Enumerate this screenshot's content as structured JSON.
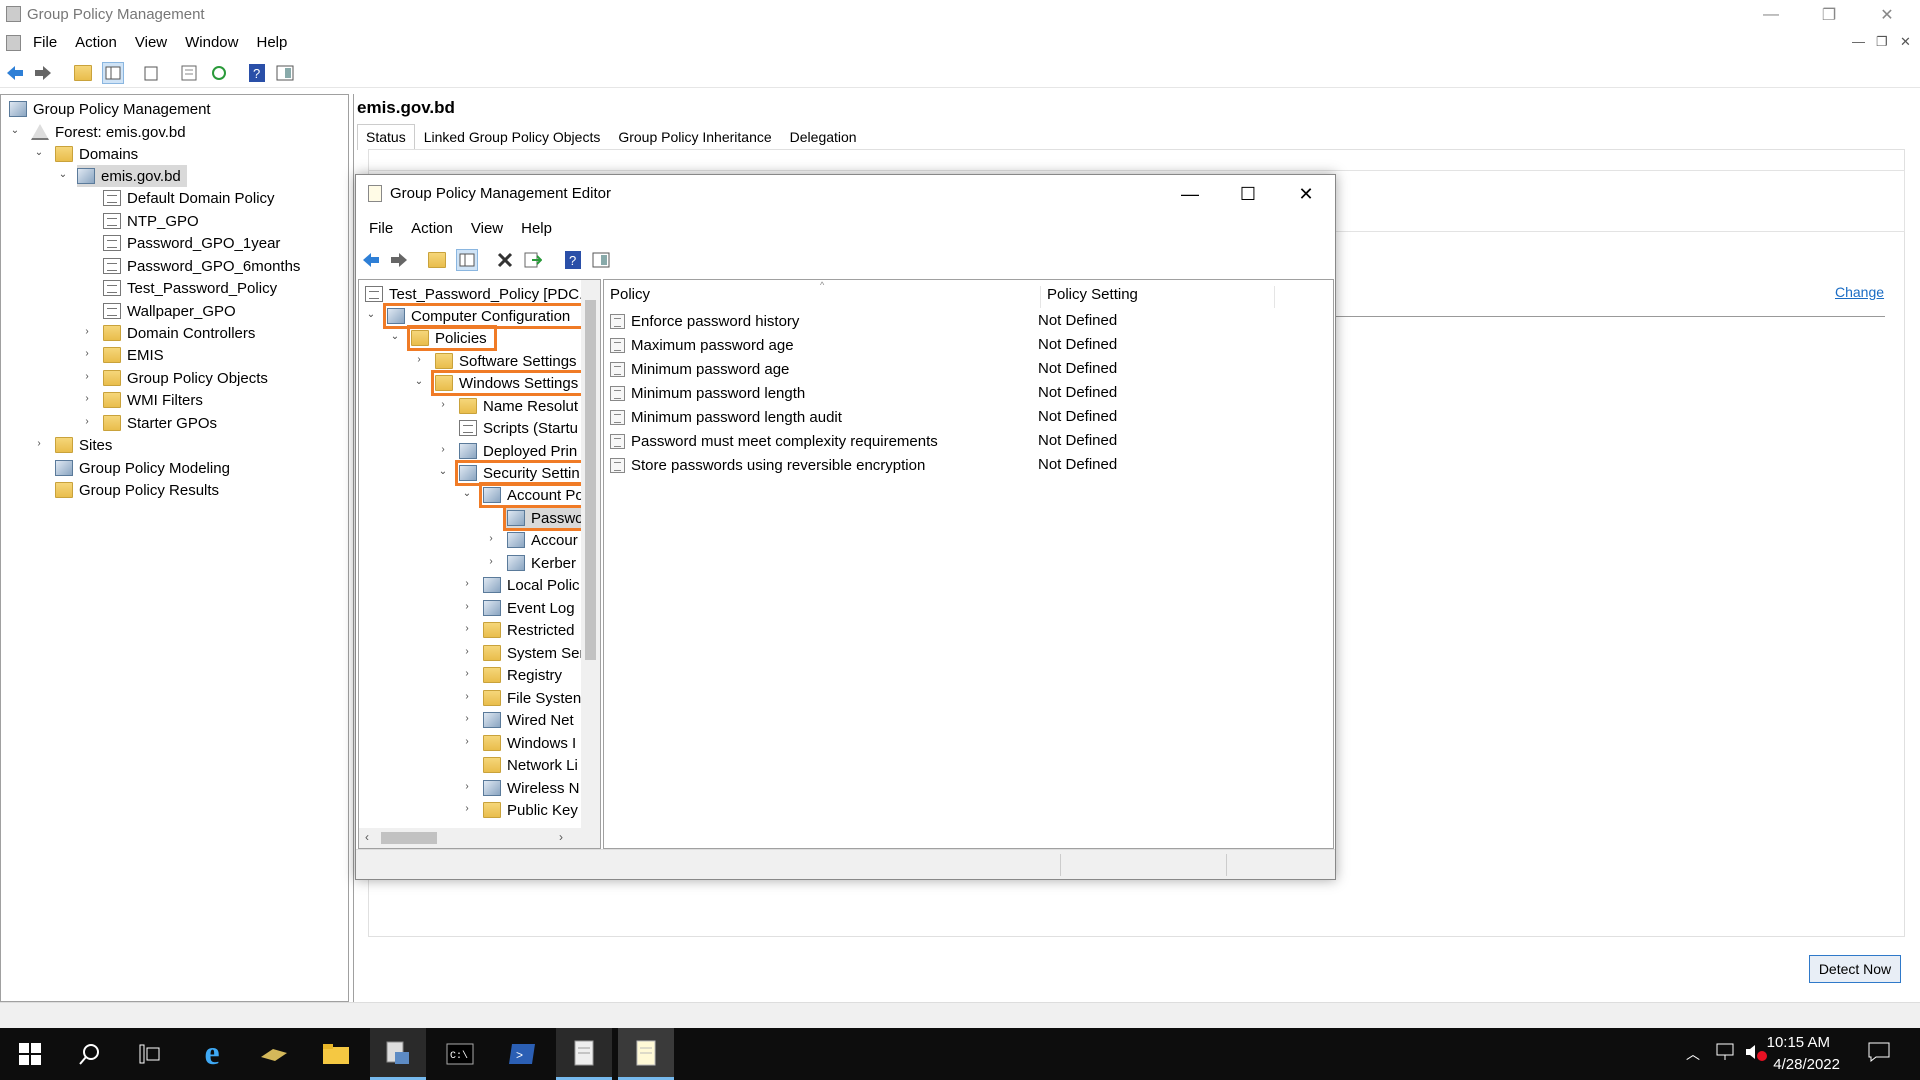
{
  "window": {
    "title": "Group Policy Management"
  },
  "menu": [
    "File",
    "Action",
    "View",
    "Window",
    "Help"
  ],
  "tree": {
    "root": "Group Policy Management",
    "forest": "Forest: emis.gov.bd",
    "domains": "Domains",
    "domain": "emis.gov.bd",
    "gpos": [
      "Default Domain Policy",
      "NTP_GPO",
      "Password_GPO_1year",
      "Password_GPO_6months",
      "Test_Password_Policy",
      "Wallpaper_GPO"
    ],
    "ous": [
      "Domain Controllers",
      "EMIS",
      "Group Policy Objects",
      "WMI Filters",
      "Starter GPOs"
    ],
    "sites": "Sites",
    "modeling": "Group Policy Modeling",
    "results": "Group Policy Results"
  },
  "right": {
    "title": "emis.gov.bd",
    "tabs": [
      "Status",
      "Linked Group Policy Objects",
      "Group Policy Inheritance",
      "Delegation"
    ],
    "change_link": "Change",
    "detect_button": "Detect Now"
  },
  "editor": {
    "title": "Group Policy Management Editor",
    "menu": [
      "File",
      "Action",
      "View",
      "Help"
    ],
    "tree_root": "Test_Password_Policy [PDC.EM",
    "tree": [
      {
        "label": "Computer Configuration",
        "level": 1
      },
      {
        "label": "Policies",
        "level": 2
      },
      {
        "label": "Software Settings",
        "level": 3
      },
      {
        "label": "Windows Settings",
        "level": 3
      },
      {
        "label": "Name Resolut",
        "level": 4
      },
      {
        "label": "Scripts (Startu",
        "level": 4
      },
      {
        "label": "Deployed Prin",
        "level": 4
      },
      {
        "label": "Security Settin",
        "level": 4
      },
      {
        "label": "Account Po",
        "level": 5
      },
      {
        "label": "Passwo",
        "level": 6
      },
      {
        "label": "Accour",
        "level": 6
      },
      {
        "label": "Kerber",
        "level": 6
      },
      {
        "label": "Local Polic",
        "level": 5
      },
      {
        "label": "Event Log",
        "level": 5
      },
      {
        "label": "Restricted",
        "level": 5
      },
      {
        "label": "System Ser",
        "level": 5
      },
      {
        "label": "Registry",
        "level": 5
      },
      {
        "label": "File Systen",
        "level": 5
      },
      {
        "label": "Wired Net",
        "level": 5
      },
      {
        "label": "Windows I",
        "level": 5
      },
      {
        "label": "Network Li",
        "level": 5
      },
      {
        "label": "Wireless N",
        "level": 5
      },
      {
        "label": "Public Key",
        "level": 5
      }
    ],
    "list_headers": [
      "Policy",
      "Policy Setting"
    ],
    "policies": [
      {
        "name": "Enforce password history",
        "setting": "Not Defined"
      },
      {
        "name": "Maximum password age",
        "setting": "Not Defined"
      },
      {
        "name": "Minimum password age",
        "setting": "Not Defined"
      },
      {
        "name": "Minimum password length",
        "setting": "Not Defined"
      },
      {
        "name": "Minimum password length audit",
        "setting": "Not Defined"
      },
      {
        "name": "Password must meet complexity requirements",
        "setting": "Not Defined"
      },
      {
        "name": "Store passwords using reversible encryption",
        "setting": "Not Defined"
      }
    ]
  },
  "taskbar": {
    "time": "10:15 AM",
    "date": "4/28/2022"
  }
}
